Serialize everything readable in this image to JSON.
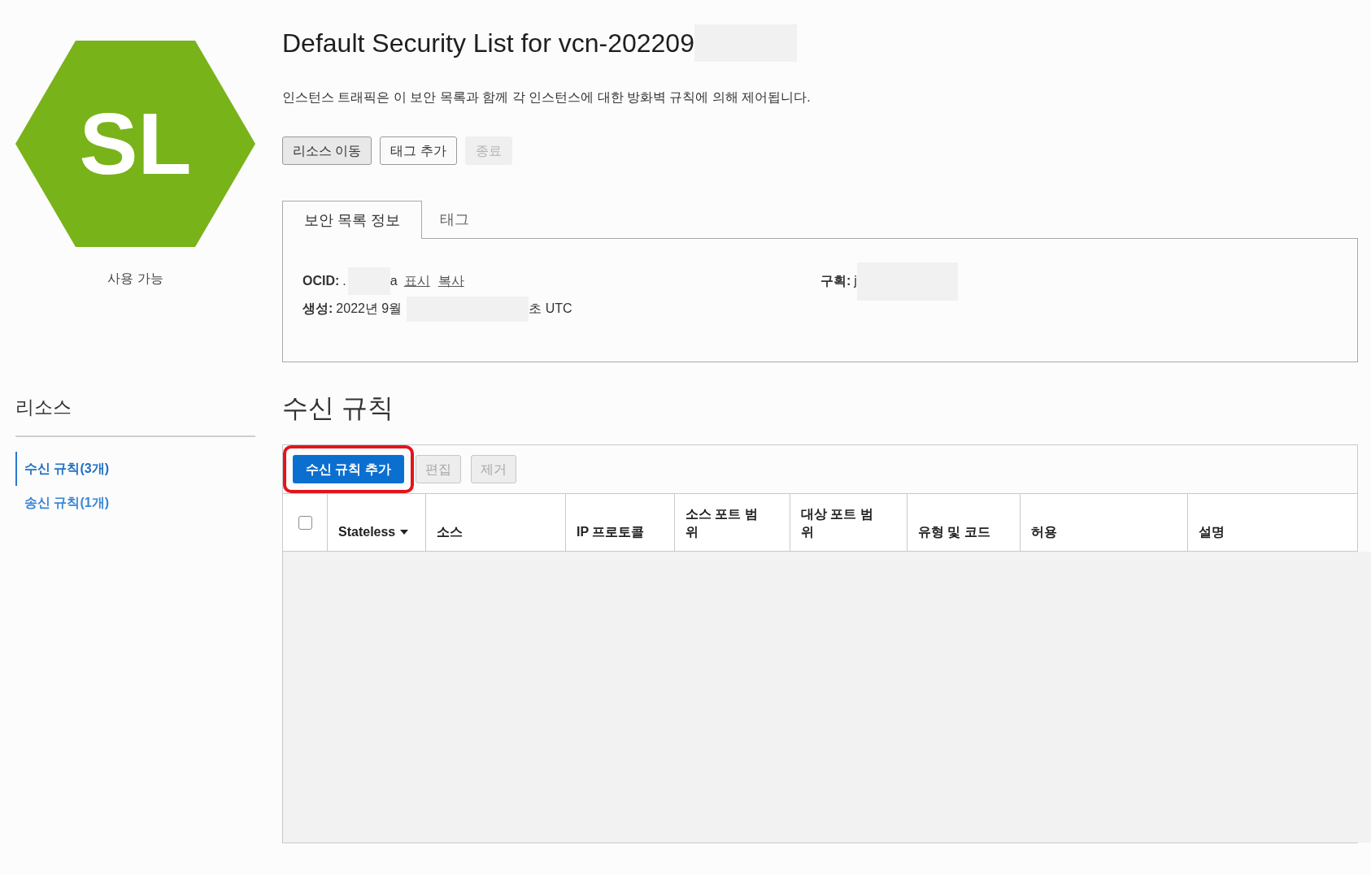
{
  "page": {
    "title": "Default Security List for vcn-202209",
    "description": "인스턴스 트래픽은 이 보안 목록과 함께 각 인스턴스에 대한 방화벽 규칙에 의해 제어됩니다."
  },
  "badge": {
    "initials": "SL",
    "status": "사용 가능"
  },
  "actions": [
    {
      "label": "리소스 이동",
      "disabled": false,
      "hovered": true
    },
    {
      "label": "태그 추가",
      "disabled": false,
      "hovered": false
    },
    {
      "label": "종료",
      "disabled": true,
      "hovered": false
    }
  ],
  "tabs": [
    {
      "label": "보안 목록 정보",
      "selected": true
    },
    {
      "label": "태그",
      "selected": false
    }
  ],
  "details": {
    "ocid": {
      "label": "OCID:",
      "value_start": ".",
      "value_end": "a",
      "links": [
        "표시",
        "복사"
      ]
    },
    "created": {
      "label": "생성:",
      "value_start": "2022년 9월",
      "value_end": "초 UTC"
    },
    "compartment": {
      "label": "구획:",
      "value": "j"
    }
  },
  "resources": {
    "title": "리소스",
    "items": [
      {
        "label": "수신 규칙(3개)",
        "selected": true
      },
      {
        "label": "송신 규칙(1개)",
        "selected": false
      }
    ]
  },
  "ingress_rules": {
    "title": "수신 규칙",
    "toolbar": [
      {
        "label": "수신 규칙 추가",
        "kind": "primary",
        "disabled": false,
        "highlighted": true
      },
      {
        "label": "편집",
        "kind": "secondary",
        "disabled": true,
        "highlighted": false
      },
      {
        "label": "제거",
        "kind": "secondary",
        "disabled": true,
        "highlighted": false
      }
    ],
    "columns": [
      {
        "kind": "checkbox",
        "checked": false
      },
      {
        "kind": "menu",
        "label": "Stateless"
      },
      {
        "kind": "text",
        "label": "소스"
      },
      {
        "kind": "text",
        "label": "IP 프로토콜"
      },
      {
        "kind": "text",
        "label": "소스 포트 범위"
      },
      {
        "kind": "text",
        "label": "대상 포트 범위"
      },
      {
        "kind": "text",
        "label": "유형 및 코드"
      },
      {
        "kind": "text",
        "label": "허용"
      },
      {
        "kind": "text",
        "label": "설명"
      }
    ]
  }
}
